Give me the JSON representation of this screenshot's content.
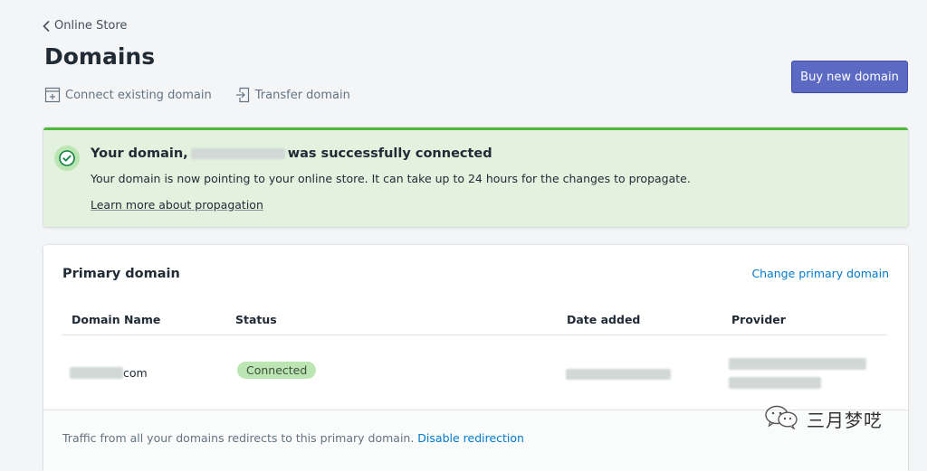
{
  "breadcrumb": {
    "label": "Online Store"
  },
  "page": {
    "title": "Domains"
  },
  "actions": {
    "connect_existing": "Connect existing domain",
    "transfer": "Transfer domain"
  },
  "buy_button": {
    "label": "Buy new domain"
  },
  "banner": {
    "title_prefix": "Your domain,",
    "title_suffix": "was successfully connected",
    "message": "Your domain is now pointing to your online store. It can take up to 24 hours for the changes to propagate.",
    "link": "Learn more about propagation",
    "status_color": "#50b83c"
  },
  "card": {
    "title": "Primary domain",
    "action_link": "Change primary domain",
    "columns": [
      "Domain Name",
      "Status",
      "Date added",
      "Provider"
    ],
    "rows": [
      {
        "domain_suffix": "com",
        "status": "Connected"
      }
    ],
    "footer_text": "Traffic from all your domains redirects to this primary domain.",
    "footer_link": "Disable redirection"
  },
  "watermark": {
    "text": "三月梦呓"
  },
  "colors": {
    "accent": "#5c6ac4",
    "link": "#007ace",
    "success": "#50b83c"
  }
}
